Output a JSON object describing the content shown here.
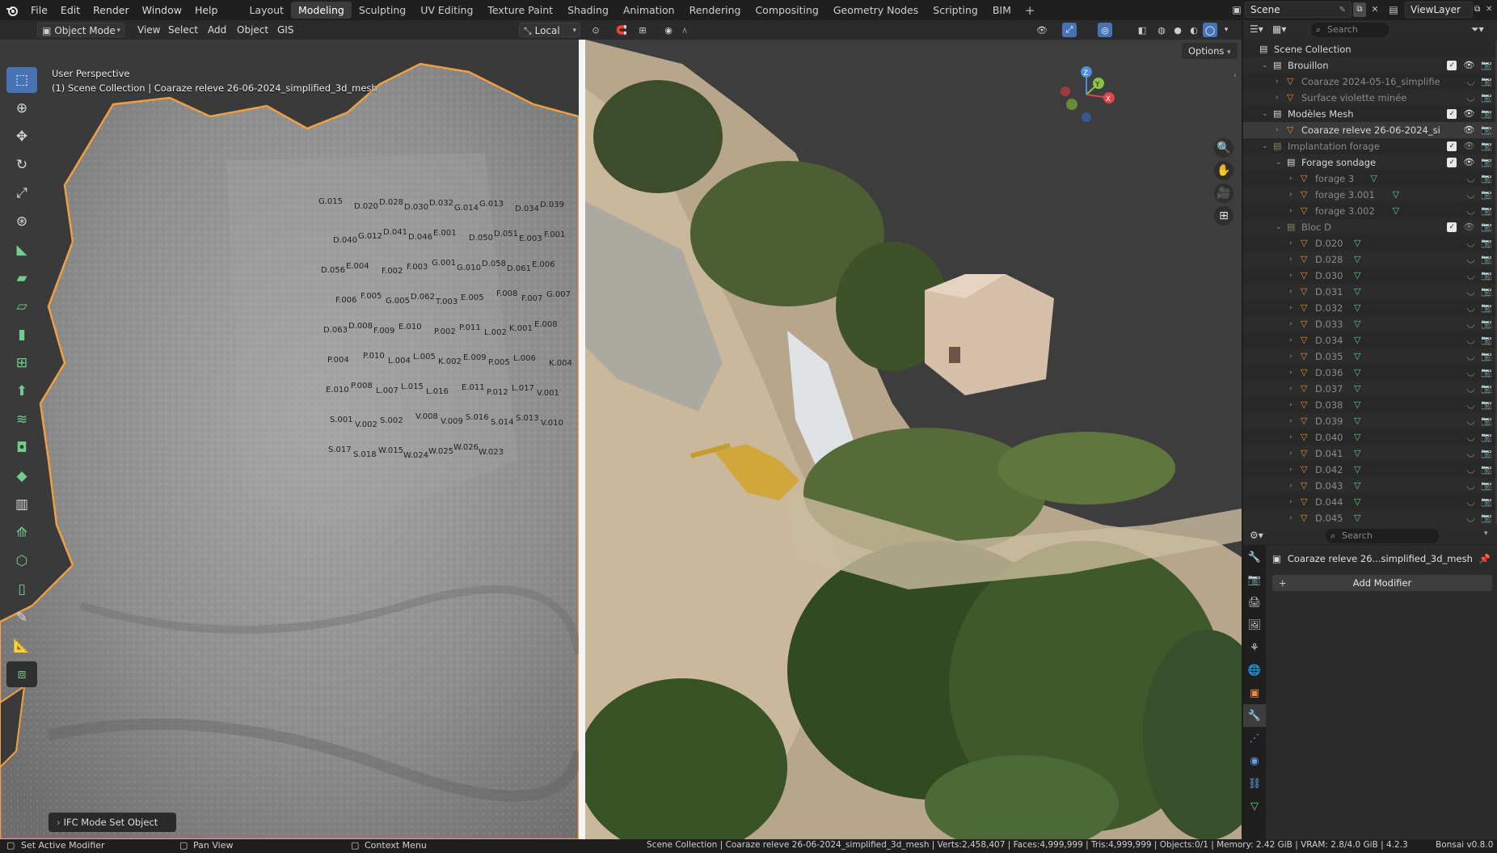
{
  "menubar": {
    "items": [
      "File",
      "Edit",
      "Render",
      "Window",
      "Help"
    ],
    "workspaces": [
      "Layout",
      "Modeling",
      "Sculpting",
      "UV Editing",
      "Texture Paint",
      "Shading",
      "Animation",
      "Rendering",
      "Compositing",
      "Geometry Nodes",
      "Scripting",
      "BIM"
    ],
    "active_workspace": "Modeling",
    "add_tab": "+",
    "scene": "Scene",
    "view_layer": "ViewLayer"
  },
  "viewport_header": {
    "mode": "Object Mode",
    "menus": [
      "View",
      "Select",
      "Add",
      "Object",
      "GIS"
    ],
    "transform_orientation": "Local",
    "options": "Options"
  },
  "viewport": {
    "perspective_label": "User Perspective",
    "object_label": "(1) Scene Collection | Coaraze releve 26-06-2024_simplified_3d_mesh",
    "ifc_panel": "IFC Mode Set Object",
    "gizmo_axes": [
      "Z",
      "Y",
      "X"
    ],
    "mesh_labels": [
      "G.015",
      "D.020",
      "D.028",
      "D.030",
      "D.032",
      "G.014",
      "G.013",
      "D.034",
      "D.039",
      "D.040",
      "G.012",
      "D.041",
      "D.046",
      "E.001",
      "D.050",
      "D.051",
      "E.003",
      "F.001",
      "D.056",
      "E.004",
      "F.002",
      "F.003",
      "G.001",
      "G.010",
      "D.058",
      "D.061",
      "E.006",
      "F.006",
      "F.005",
      "G.005",
      "D.062",
      "T.003",
      "E.005",
      "F.008",
      "F.007",
      "G.007",
      "D.063",
      "D.008",
      "F.009",
      "E.010",
      "P.002",
      "P.011",
      "L.002",
      "K.001",
      "E.008",
      "P.004",
      "P.010",
      "L.004",
      "L.005",
      "K.002",
      "E.009",
      "P.005",
      "L.006",
      "K.004",
      "E.010",
      "P.008",
      "L.007",
      "L.015",
      "L.016",
      "E.011",
      "P.012",
      "L.017",
      "V.001",
      "S.001",
      "V.002",
      "S.002",
      "V.008",
      "V.009",
      "S.016",
      "S.014",
      "S.013",
      "V.010",
      "S.017",
      "S.018",
      "W.015",
      "W.024",
      "W.025",
      "W.026",
      "W.023"
    ]
  },
  "outliner": {
    "search_placeholder": "Search",
    "rows": [
      {
        "label": "Scene Collection",
        "type": "scene",
        "indent": 0
      },
      {
        "label": "Brouillon",
        "type": "collection",
        "indent": 1,
        "checked": true
      },
      {
        "label": "Coaraze 2024-05-16_simplifie",
        "type": "mesh",
        "indent": 2,
        "dim": true
      },
      {
        "label": "Surface violette minée",
        "type": "mesh",
        "indent": 2,
        "dim": true
      },
      {
        "label": "Modèles Mesh",
        "type": "collection",
        "indent": 1,
        "checked": true
      },
      {
        "label": "Coaraze releve 26-06-2024_si",
        "type": "mesh",
        "indent": 2,
        "selected": true
      },
      {
        "label": "Implantation forage",
        "type": "collection",
        "indent": 1,
        "checked": true,
        "dim": true
      },
      {
        "label": "Forage sondage",
        "type": "collection",
        "indent": 2,
        "checked": true
      },
      {
        "label": "forage 3",
        "type": "mesh",
        "indent": 3,
        "dim": true
      },
      {
        "label": "forage 3.001",
        "type": "mesh",
        "indent": 3,
        "dim": true
      },
      {
        "label": "forage 3.002",
        "type": "mesh",
        "indent": 3,
        "dim": true
      },
      {
        "label": "Bloc D",
        "type": "collection",
        "indent": 2,
        "checked": true,
        "dim": true
      },
      {
        "label": "D.020",
        "type": "mesh",
        "indent": 3,
        "dim": true
      },
      {
        "label": "D.028",
        "type": "mesh",
        "indent": 3,
        "dim": true
      },
      {
        "label": "D.030",
        "type": "mesh",
        "indent": 3,
        "dim": true
      },
      {
        "label": "D.031",
        "type": "mesh",
        "indent": 3,
        "dim": true
      },
      {
        "label": "D.032",
        "type": "mesh",
        "indent": 3,
        "dim": true
      },
      {
        "label": "D.033",
        "type": "mesh",
        "indent": 3,
        "dim": true
      },
      {
        "label": "D.034",
        "type": "mesh",
        "indent": 3,
        "dim": true
      },
      {
        "label": "D.035",
        "type": "mesh",
        "indent": 3,
        "dim": true
      },
      {
        "label": "D.036",
        "type": "mesh",
        "indent": 3,
        "dim": true
      },
      {
        "label": "D.037",
        "type": "mesh",
        "indent": 3,
        "dim": true
      },
      {
        "label": "D.038",
        "type": "mesh",
        "indent": 3,
        "dim": true
      },
      {
        "label": "D.039",
        "type": "mesh",
        "indent": 3,
        "dim": true
      },
      {
        "label": "D.040",
        "type": "mesh",
        "indent": 3,
        "dim": true
      },
      {
        "label": "D.041",
        "type": "mesh",
        "indent": 3,
        "dim": true
      },
      {
        "label": "D.042",
        "type": "mesh",
        "indent": 3,
        "dim": true
      },
      {
        "label": "D.043",
        "type": "mesh",
        "indent": 3,
        "dim": true
      },
      {
        "label": "D.044",
        "type": "mesh",
        "indent": 3,
        "dim": true
      },
      {
        "label": "D.045",
        "type": "mesh",
        "indent": 3,
        "dim": true
      }
    ]
  },
  "properties": {
    "search_placeholder": "Search",
    "object_name": "Coaraze releve 26...simplified_3d_mesh",
    "add_modifier": "Add Modifier",
    "tabs": [
      "tool-icon",
      "render-icon",
      "output-icon",
      "view-layer-icon",
      "scene-icon",
      "world-icon",
      "object-icon",
      "modifier-icon",
      "particles-icon",
      "physics-icon",
      "constraints-icon",
      "data-icon"
    ],
    "active_tab": "modifier-icon"
  },
  "statusbar": {
    "left_hint": "Set Active Modifier",
    "middle_hint": "Pan View",
    "right_hint": "Context Menu",
    "info": "Scene Collection | Coaraze releve 26-06-2024_simplified_3d_mesh | Verts:2,458,407 | Faces:4,999,999 | Tris:4,999,999 | Objects:0/1 | Memory: 2.42 GiB | VRAM: 2.8/4.0 GiB | 4.2.3",
    "version": "Bonsai v0.8.0"
  },
  "colors": {
    "accent": "#4772b3",
    "selection_outline": "#f0a040",
    "gizmo_x": "#e0444a",
    "gizmo_y": "#8bc34a",
    "gizmo_z": "#4a8fe0"
  }
}
